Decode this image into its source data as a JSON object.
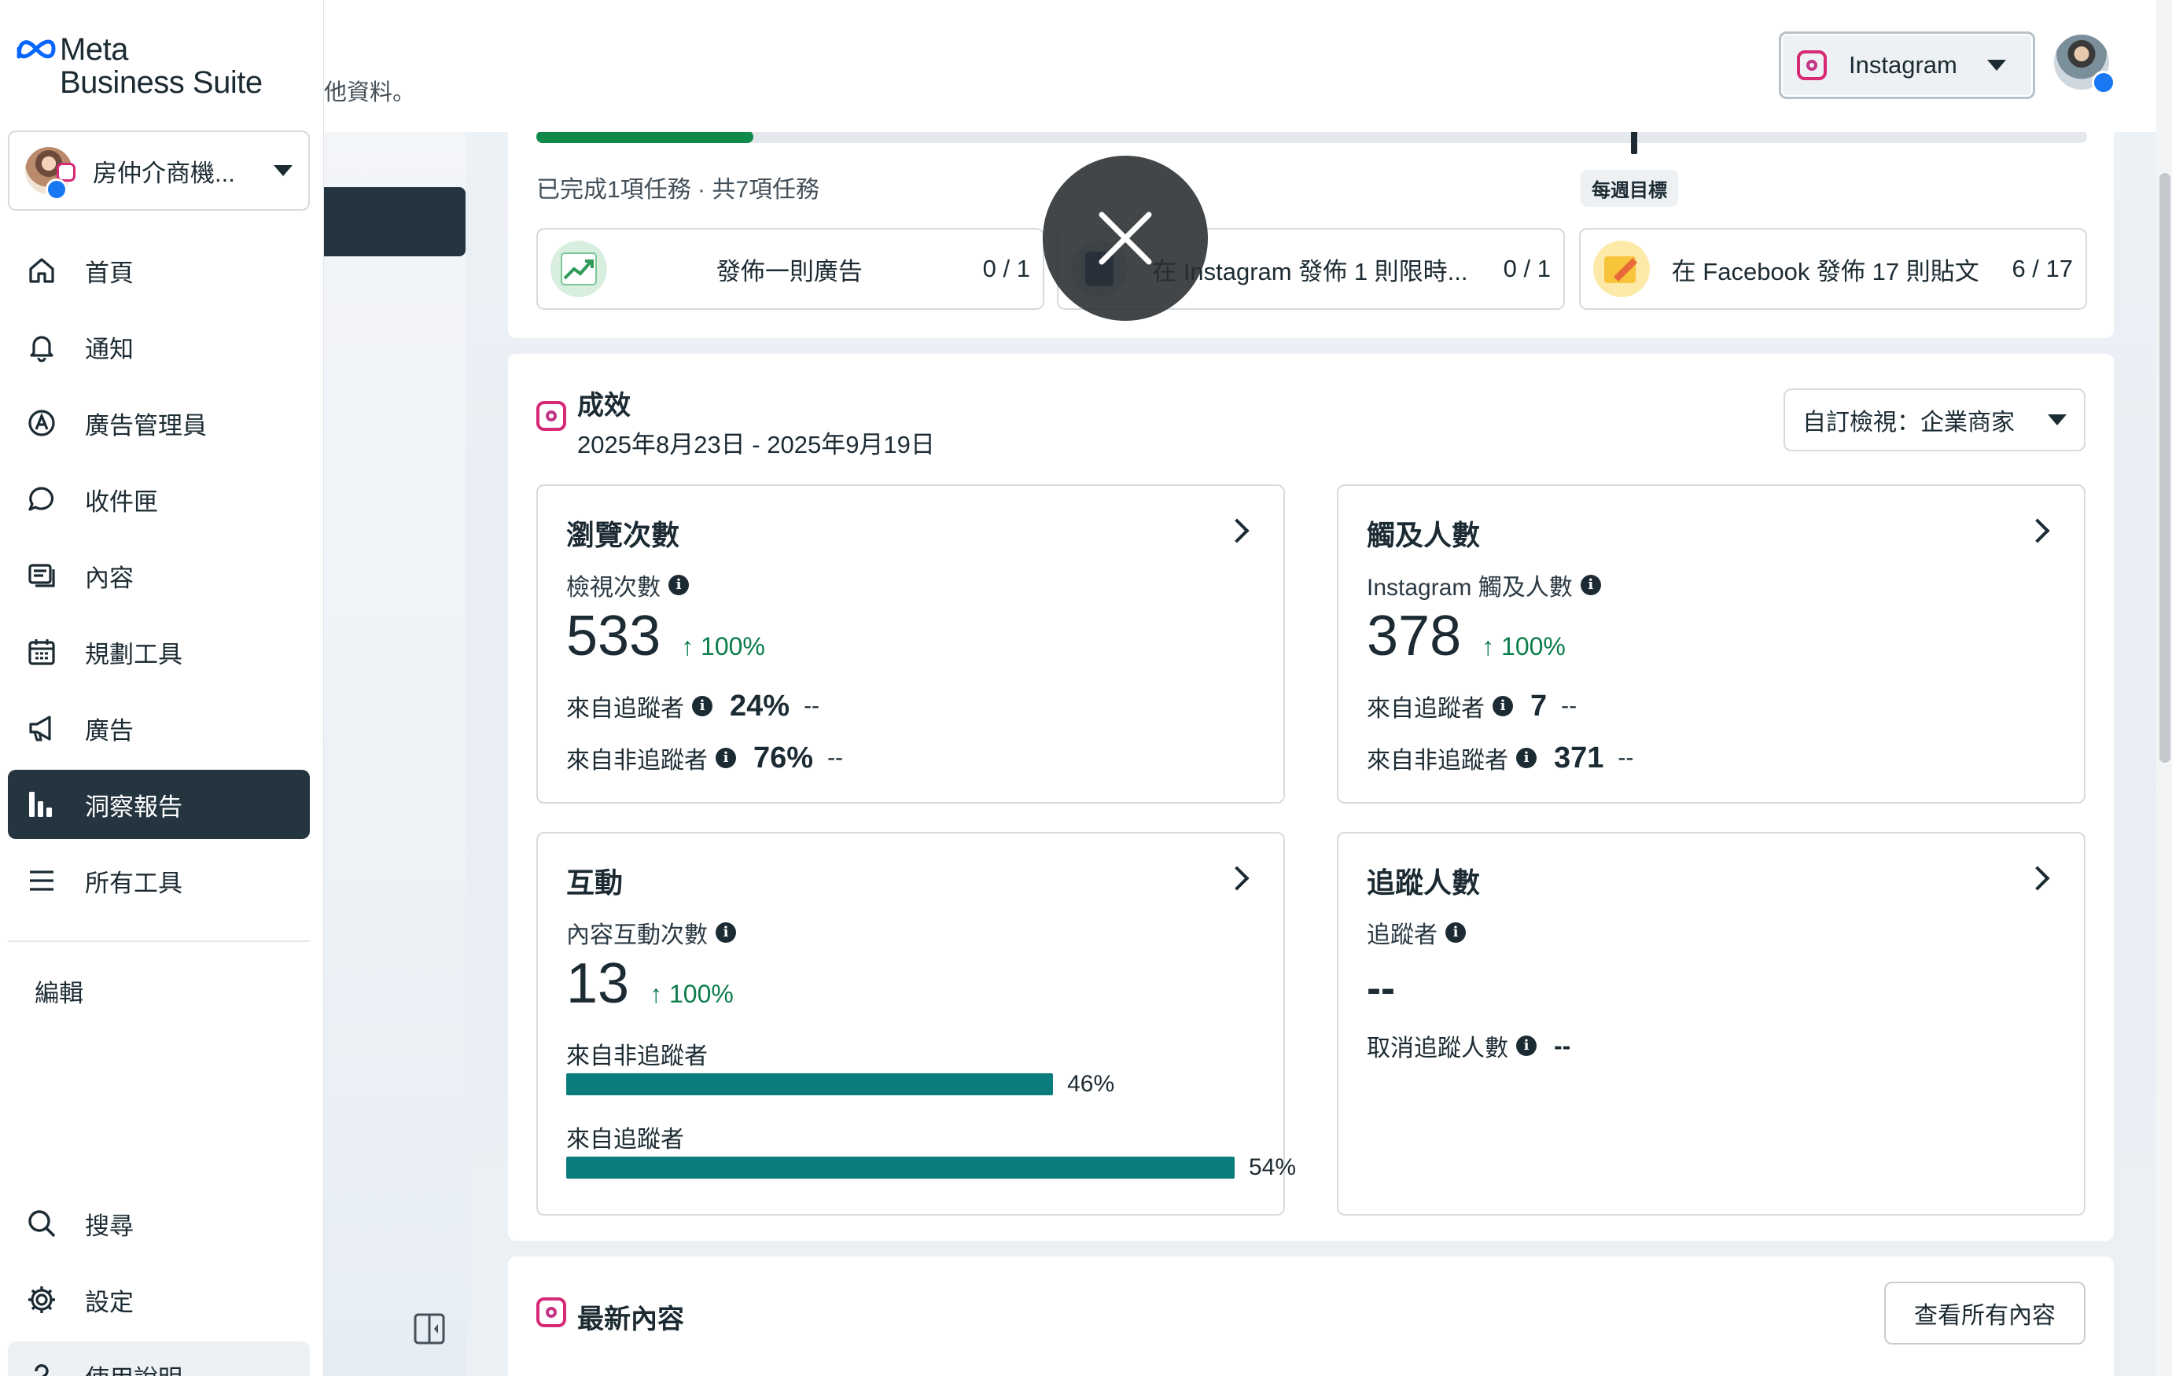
{
  "brand": {
    "line1": "Meta",
    "line2": "Business Suite"
  },
  "account": {
    "name": "房仲介商機..."
  },
  "sidebar": {
    "items": [
      {
        "label": "首頁",
        "icon": "home-icon"
      },
      {
        "label": "通知",
        "icon": "bell-icon"
      },
      {
        "label": "廣告管理員",
        "icon": "ads-manager-icon"
      },
      {
        "label": "收件匣",
        "icon": "chat-bubble-icon"
      },
      {
        "label": "內容",
        "icon": "content-icon"
      },
      {
        "label": "規劃工具",
        "icon": "calendar-icon"
      },
      {
        "label": "廣告",
        "icon": "megaphone-icon"
      },
      {
        "label": "洞察報告",
        "icon": "insights-icon"
      },
      {
        "label": "所有工具",
        "icon": "menu-icon"
      }
    ],
    "active_index": 7,
    "edit_label": "編輯",
    "bottom_items": [
      {
        "label": "搜尋",
        "icon": "search-icon"
      },
      {
        "label": "設定",
        "icon": "gear-icon"
      },
      {
        "label": "使用說明",
        "icon": "help-icon"
      }
    ]
  },
  "topbar": {
    "truncated_text": "他資料。",
    "platform": "Instagram"
  },
  "goals": {
    "progress_fraction": 0.14,
    "summary": "已完成1項任務 · 共7項任務",
    "weekly_badge": "每週目標",
    "tasks": [
      {
        "title": "發佈一則廣告",
        "count": "0 / 1"
      },
      {
        "title": "在 Instagram 發佈 1 則限時...",
        "count": "0 / 1"
      },
      {
        "title": "在 Facebook 發佈 17 則貼文",
        "count": "6 / 17"
      }
    ]
  },
  "performance": {
    "title": "成效",
    "date_range": "2025年8月23日 - 2025年9月19日",
    "view_select": "自訂檢視：企業商家",
    "views": {
      "title": "瀏覽次數",
      "subtitle": "檢視次數",
      "value": "533",
      "change": "↑ 100%",
      "row1_label": "來自追蹤者",
      "row1_value": "24%",
      "row1_dash": "--",
      "row2_label": "來自非追蹤者",
      "row2_value": "76%",
      "row2_dash": "--"
    },
    "reach": {
      "title": "觸及人數",
      "subtitle": "Instagram 觸及人數",
      "value": "378",
      "change": "↑ 100%",
      "row1_label": "來自追蹤者",
      "row1_value": "7",
      "row1_dash": "--",
      "row2_label": "來自非追蹤者",
      "row2_value": "371",
      "row2_dash": "--"
    },
    "interactions": {
      "title": "互動",
      "subtitle": "內容互動次數",
      "value": "13",
      "change": "↑ 100%",
      "bar1_label": "來自非追蹤者",
      "bar1_pct": "46%",
      "bar1_value": 46,
      "bar2_label": "來自追蹤者",
      "bar2_pct": "54%",
      "bar2_value": 54
    },
    "followers": {
      "title": "追蹤人數",
      "subtitle": "追蹤者",
      "value": "--",
      "unfollow_label": "取消追蹤人數",
      "unfollow_value": "--"
    }
  },
  "latest": {
    "title": "最新內容",
    "see_all": "查看所有內容"
  },
  "colors": {
    "accent_dark": "#253540",
    "progress_green": "#0f8a4a",
    "bar_teal": "#0b7c7c",
    "change_green": "#0a7d4b"
  }
}
